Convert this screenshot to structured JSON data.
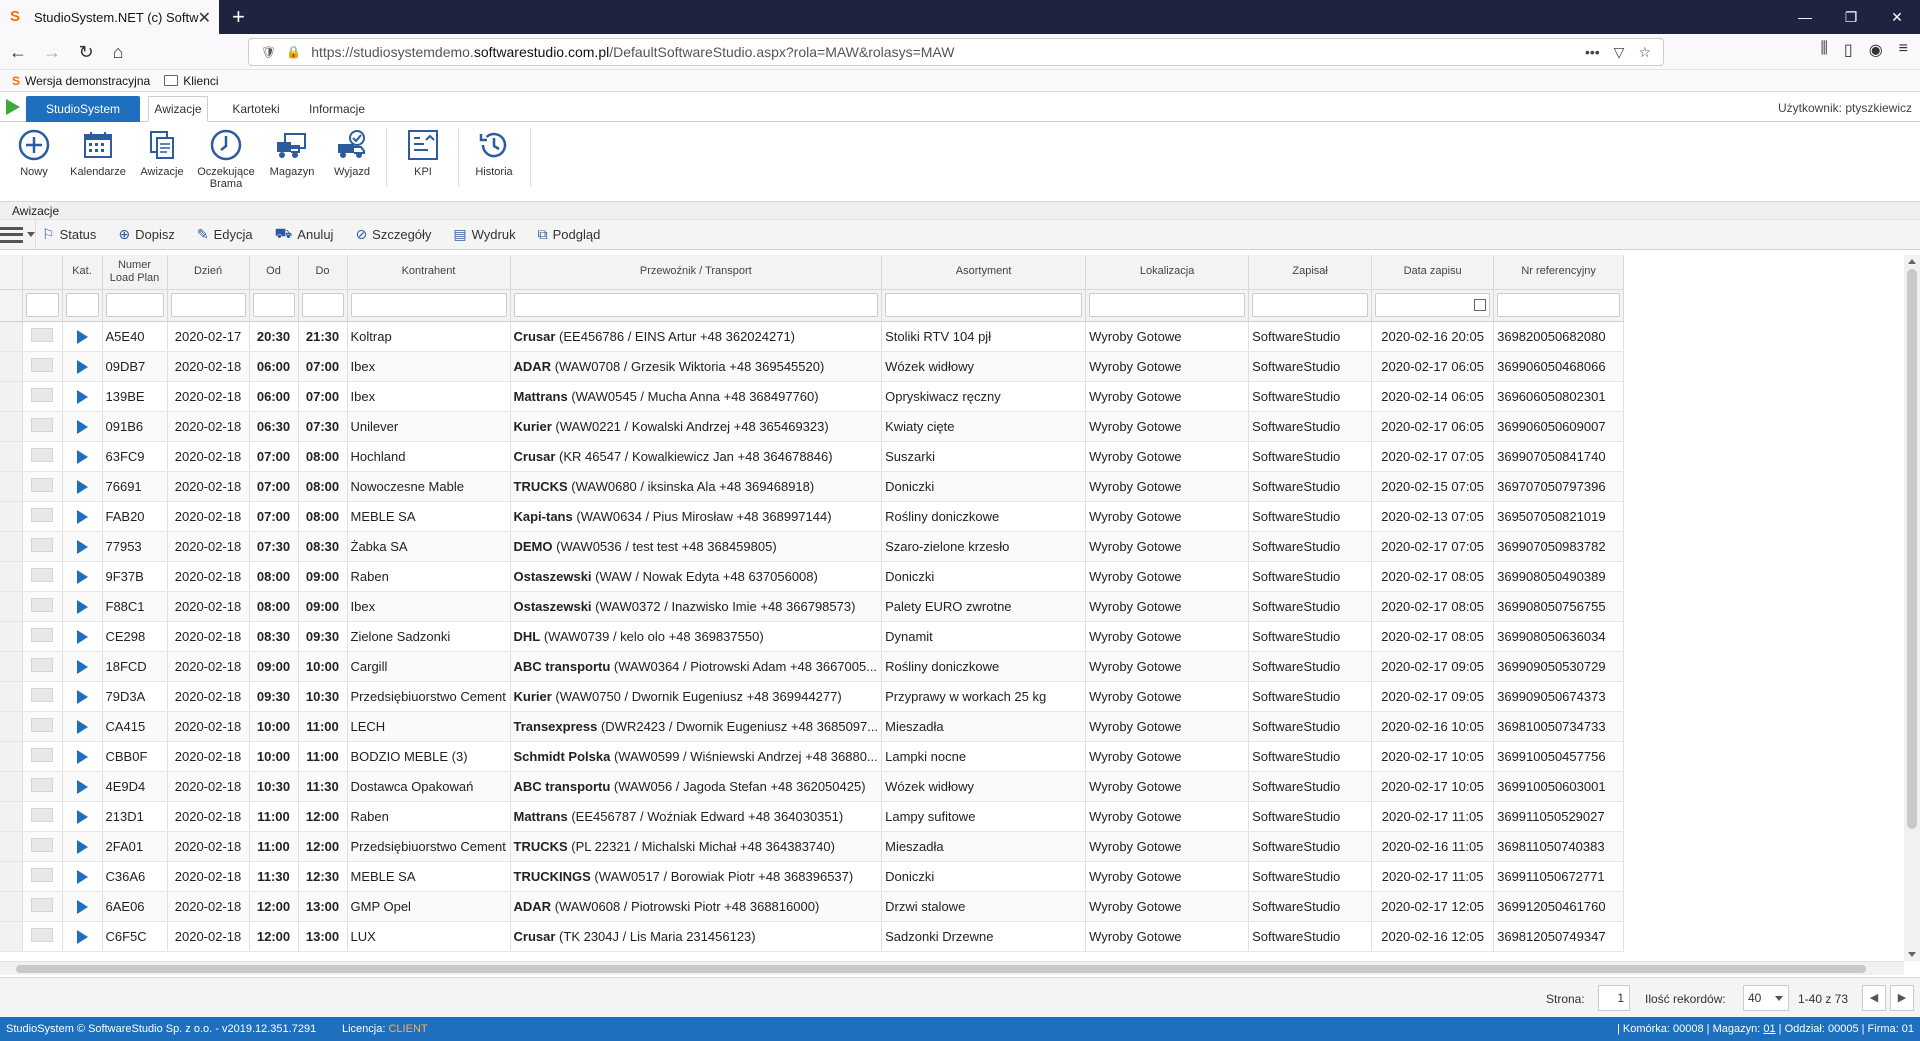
{
  "browser": {
    "tab_title": "StudioSystem.NET (c) SoftwareStudio",
    "favicon": "S",
    "url_prefix": "https://studiosystemdemo.",
    "url_domain": "softwarestudio.com.pl",
    "url_path": "/DefaultSoftwareStudio.aspx?rola=MAW&rolasys=MAW",
    "bookmarks": [
      "Wersja demonstracyjna",
      "Klienci"
    ]
  },
  "app": {
    "studio_button": "StudioSystem",
    "tabs": [
      "Awizacje",
      "Kartoteki",
      "Informacje"
    ],
    "user_label": "Użytkownik: ptyszkiewicz"
  },
  "ribbon": [
    {
      "label": "Nowy",
      "icon": "plus-circle-icon"
    },
    {
      "label": "Kalendarze",
      "icon": "calendar-icon"
    },
    {
      "label": "Awizacje",
      "icon": "documents-icon"
    },
    {
      "label": "Oczekujące Brama",
      "icon": "clock-icon"
    },
    {
      "label": "Magazyn",
      "icon": "warehouse-truck-icon"
    },
    {
      "label": "Wyjazd",
      "icon": "truck-check-icon"
    },
    {
      "label": "KPI",
      "icon": "kpi-chart-icon"
    },
    {
      "label": "Historia",
      "icon": "history-icon"
    }
  ],
  "section_label": "Awizacje",
  "toolbar": [
    {
      "label": "Status",
      "icon": "flag-icon"
    },
    {
      "label": "Dopisz",
      "icon": "plus-icon"
    },
    {
      "label": "Edycja",
      "icon": "edit-icon"
    },
    {
      "label": "Anuluj",
      "icon": "truck-cancel-icon"
    },
    {
      "label": "Szczegóły",
      "icon": "details-icon"
    },
    {
      "label": "Wydruk",
      "icon": "print-icon"
    },
    {
      "label": "Podgląd",
      "icon": "preview-icon"
    }
  ],
  "columns": [
    "Kat.",
    "Numer Load Plan",
    "Dzień",
    "Od",
    "Do",
    "Kontrahent",
    "Przewoźnik / Transport",
    "Asortyment",
    "Lokalizacja",
    "Zapisał",
    "Data zapisu",
    "Nr referencyjny"
  ],
  "rows": [
    {
      "num": "A5E40",
      "day": "2020-02-17",
      "od": "20:30",
      "do": "21:30",
      "kontrahent": "Koltrap",
      "carrier": "Crusar",
      "carrier_detail": "(EE456786 / EINS Artur +48 362024271)",
      "asort": "Stoliki RTV 104 pjł",
      "lok": "Wyroby Gotowe",
      "zapisal": "SoftwareStudio",
      "data": "2020-02-16 20:05",
      "ref": "369820050682080"
    },
    {
      "num": "09DB7",
      "day": "2020-02-18",
      "od": "06:00",
      "do": "07:00",
      "kontrahent": "Ibex",
      "carrier": "ADAR",
      "carrier_detail": "(WAW0708 / Grzesik Wiktoria +48 369545520)",
      "asort": "Wózek widłowy",
      "lok": "Wyroby Gotowe",
      "zapisal": "SoftwareStudio",
      "data": "2020-02-17 06:05",
      "ref": "369906050468066"
    },
    {
      "num": "139BE",
      "day": "2020-02-18",
      "od": "06:00",
      "do": "07:00",
      "kontrahent": "Ibex",
      "carrier": "Mattrans",
      "carrier_detail": "(WAW0545 / Mucha Anna +48 368497760)",
      "asort": "Opryskiwacz ręczny",
      "lok": "Wyroby Gotowe",
      "zapisal": "SoftwareStudio",
      "data": "2020-02-14 06:05",
      "ref": "369606050802301"
    },
    {
      "num": "091B6",
      "day": "2020-02-18",
      "od": "06:30",
      "do": "07:30",
      "kontrahent": "Unilever",
      "carrier": "Kurier",
      "carrier_detail": "(WAW0221 / Kowalski Andrzej +48 365469323)",
      "asort": "Kwiaty cięte",
      "lok": "Wyroby Gotowe",
      "zapisal": "SoftwareStudio",
      "data": "2020-02-17 06:05",
      "ref": "369906050609007"
    },
    {
      "num": "63FC9",
      "day": "2020-02-18",
      "od": "07:00",
      "do": "08:00",
      "kontrahent": "Hochland",
      "carrier": "Crusar",
      "carrier_detail": "(KR 46547 / Kowalkiewicz Jan +48 364678846)",
      "asort": "Suszarki",
      "lok": "Wyroby Gotowe",
      "zapisal": "SoftwareStudio",
      "data": "2020-02-17 07:05",
      "ref": "369907050841740"
    },
    {
      "num": "76691",
      "day": "2020-02-18",
      "od": "07:00",
      "do": "08:00",
      "kontrahent": "Nowoczesne Mable",
      "carrier": "TRUCKS",
      "carrier_detail": "(WAW0680 / iksinska Ala +48 369468918)",
      "asort": "Doniczki",
      "lok": "Wyroby Gotowe",
      "zapisal": "SoftwareStudio",
      "data": "2020-02-15 07:05",
      "ref": "369707050797396"
    },
    {
      "num": "FAB20",
      "day": "2020-02-18",
      "od": "07:00",
      "do": "08:00",
      "kontrahent": "MEBLE SA",
      "carrier": "Kapi-tans",
      "carrier_detail": "(WAW0634 / Pius Mirosław +48 368997144)",
      "asort": "Rośliny doniczkowe",
      "lok": "Wyroby Gotowe",
      "zapisal": "SoftwareStudio",
      "data": "2020-02-13 07:05",
      "ref": "369507050821019"
    },
    {
      "num": "77953",
      "day": "2020-02-18",
      "od": "07:30",
      "do": "08:30",
      "kontrahent": "Żabka SA",
      "carrier": "DEMO",
      "carrier_detail": "(WAW0536 / test test +48 368459805)",
      "asort": "Szaro-zielone krzesło",
      "lok": "Wyroby Gotowe",
      "zapisal": "SoftwareStudio",
      "data": "2020-02-17 07:05",
      "ref": "369907050983782"
    },
    {
      "num": "9F37B",
      "day": "2020-02-18",
      "od": "08:00",
      "do": "09:00",
      "kontrahent": "Raben",
      "carrier": "Ostaszewski",
      "carrier_detail": "(WAW / Nowak Edyta +48 637056008)",
      "asort": "Doniczki",
      "lok": "Wyroby Gotowe",
      "zapisal": "SoftwareStudio",
      "data": "2020-02-17 08:05",
      "ref": "369908050490389"
    },
    {
      "num": "F88C1",
      "day": "2020-02-18",
      "od": "08:00",
      "do": "09:00",
      "kontrahent": "Ibex",
      "carrier": "Ostaszewski",
      "carrier_detail": "(WAW0372 / Inazwisko Imie +48 366798573)",
      "asort": "Palety EURO zwrotne",
      "lok": "Wyroby Gotowe",
      "zapisal": "SoftwareStudio",
      "data": "2020-02-17 08:05",
      "ref": "369908050756755"
    },
    {
      "num": "CE298",
      "day": "2020-02-18",
      "od": "08:30",
      "do": "09:30",
      "kontrahent": "Zielone Sadzonki",
      "carrier": "DHL",
      "carrier_detail": "(WAW0739 / kelo olo +48 369837550)",
      "asort": "Dynamit",
      "lok": "Wyroby Gotowe",
      "zapisal": "SoftwareStudio",
      "data": "2020-02-17 08:05",
      "ref": "369908050636034"
    },
    {
      "num": "18FCD",
      "day": "2020-02-18",
      "od": "09:00",
      "do": "10:00",
      "kontrahent": "Cargill",
      "carrier": "ABC transportu",
      "carrier_detail": "(WAW0364 / Piotrowski Adam +48 3667005...",
      "asort": "Rośliny doniczkowe",
      "lok": "Wyroby Gotowe",
      "zapisal": "SoftwareStudio",
      "data": "2020-02-17 09:05",
      "ref": "369909050530729"
    },
    {
      "num": "79D3A",
      "day": "2020-02-18",
      "od": "09:30",
      "do": "10:30",
      "kontrahent": "Przedsiębiuorstwo Cement",
      "carrier": "Kurier",
      "carrier_detail": "(WAW0750 / Dwornik Eugeniusz +48 369944277)",
      "asort": "Przyprawy w workach 25 kg",
      "lok": "Wyroby Gotowe",
      "zapisal": "SoftwareStudio",
      "data": "2020-02-17 09:05",
      "ref": "369909050674373"
    },
    {
      "num": "CA415",
      "day": "2020-02-18",
      "od": "10:00",
      "do": "11:00",
      "kontrahent": "LECH",
      "carrier": "Transexpress",
      "carrier_detail": "(DWR2423 / Dwornik Eugeniusz +48 3685097...",
      "asort": "Mieszadła",
      "lok": "Wyroby Gotowe",
      "zapisal": "SoftwareStudio",
      "data": "2020-02-16 10:05",
      "ref": "369810050734733"
    },
    {
      "num": "CBB0F",
      "day": "2020-02-18",
      "od": "10:00",
      "do": "11:00",
      "kontrahent": "BODZIO MEBLE (3)",
      "carrier": "Schmidt Polska",
      "carrier_detail": "(WAW0599 / Wiśniewski Andrzej +48 36880...",
      "asort": "Lampki nocne",
      "lok": "Wyroby Gotowe",
      "zapisal": "SoftwareStudio",
      "data": "2020-02-17 10:05",
      "ref": "369910050457756"
    },
    {
      "num": "4E9D4",
      "day": "2020-02-18",
      "od": "10:30",
      "do": "11:30",
      "kontrahent": "Dostawca Opakowań",
      "carrier": "ABC transportu",
      "carrier_detail": "(WAW056 / Jagoda Stefan +48 362050425)",
      "asort": "Wózek widłowy",
      "lok": "Wyroby Gotowe",
      "zapisal": "SoftwareStudio",
      "data": "2020-02-17 10:05",
      "ref": "369910050603001"
    },
    {
      "num": "213D1",
      "day": "2020-02-18",
      "od": "11:00",
      "do": "12:00",
      "kontrahent": "Raben",
      "carrier": "Mattrans",
      "carrier_detail": "(EE456787 / Woźniak Edward +48 364030351)",
      "asort": "Lampy sufitowe",
      "lok": "Wyroby Gotowe",
      "zapisal": "SoftwareStudio",
      "data": "2020-02-17 11:05",
      "ref": "369911050529027"
    },
    {
      "num": "2FA01",
      "day": "2020-02-18",
      "od": "11:00",
      "do": "12:00",
      "kontrahent": "Przedsiębiuorstwo Cement",
      "carrier": "TRUCKS",
      "carrier_detail": "(PL 22321 / Michalski Michał +48 364383740)",
      "asort": "Mieszadła",
      "lok": "Wyroby Gotowe",
      "zapisal": "SoftwareStudio",
      "data": "2020-02-16 11:05",
      "ref": "369811050740383"
    },
    {
      "num": "C36A6",
      "day": "2020-02-18",
      "od": "11:30",
      "do": "12:30",
      "kontrahent": "MEBLE SA",
      "carrier": "TRUCKINGS",
      "carrier_detail": "(WAW0517 / Borowiak Piotr +48 368396537)",
      "asort": "Doniczki",
      "lok": "Wyroby Gotowe",
      "zapisal": "SoftwareStudio",
      "data": "2020-02-17 11:05",
      "ref": "369911050672771"
    },
    {
      "num": "6AE06",
      "day": "2020-02-18",
      "od": "12:00",
      "do": "13:00",
      "kontrahent": "GMP Opel",
      "carrier": "ADAR",
      "carrier_detail": "(WAW0608 / Piotrowski Piotr +48 368816000)",
      "asort": "Drzwi stalowe",
      "lok": "Wyroby Gotowe",
      "zapisal": "SoftwareStudio",
      "data": "2020-02-17 12:05",
      "ref": "369912050461760"
    },
    {
      "num": "C6F5C",
      "day": "2020-02-18",
      "od": "12:00",
      "do": "13:00",
      "kontrahent": "LUX",
      "carrier": "Crusar",
      "carrier_detail": "(TK 2304J / Lis Maria 231456123)",
      "asort": "Sadzonki Drzewne",
      "lok": "Wyroby Gotowe",
      "zapisal": "SoftwareStudio",
      "data": "2020-02-16 12:05",
      "ref": "369812050749347"
    }
  ],
  "pager": {
    "page_label": "Strona:",
    "page_value": "1",
    "records_label": "Ilość rekordów:",
    "records_value": "40",
    "range": "1-40 z 73"
  },
  "status": {
    "copyright": "StudioSystem © SoftwareStudio Sp. z o.o. - v2019.12.351.7291",
    "license_label": "Licencja:",
    "license_value": "CLIENT",
    "right_a": "| Komórka: 00008 | Magazyn: ",
    "right_mag": "01",
    "right_b": " | Oddział: 00005 | Firma: 01"
  },
  "colors": {
    "accent": "#1e6fbd",
    "play_green": "#3cab3c",
    "license": "#ffb24a"
  }
}
